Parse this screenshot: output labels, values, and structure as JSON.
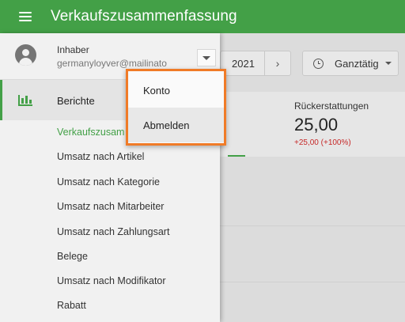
{
  "appbar": {
    "title": "Verkaufszusammenfassung"
  },
  "toolbar": {
    "date_text": "2021",
    "next_symbol": "›",
    "time_filter": "Ganztätig"
  },
  "card": {
    "label": "Rückerstattungen",
    "value": "25,00",
    "delta": "+25,00 (+100%)"
  },
  "account": {
    "role": "Inhaber",
    "email": "germanyloyver@mailinato"
  },
  "drawer": {
    "section_label": "Berichte",
    "items": [
      "Verkaufszusam",
      "Umsatz nach Artikel",
      "Umsatz nach Kategorie",
      "Umsatz nach Mitarbeiter",
      "Umsatz nach Zahlungsart",
      "Belege",
      "Umsatz nach Modifikator",
      "Rabatt"
    ]
  },
  "dropdown": {
    "items": [
      "Konto",
      "Abmelden"
    ]
  },
  "colors": {
    "primary": "#43a047",
    "highlight_border": "#f07b27",
    "negative": "#c62828"
  },
  "icons": {
    "menu": "hamburger-icon",
    "avatar": "account-circle-icon",
    "reports": "bar-chart-icon",
    "clock": "clock-icon",
    "toggle": "arrow-drop-down-icon"
  }
}
